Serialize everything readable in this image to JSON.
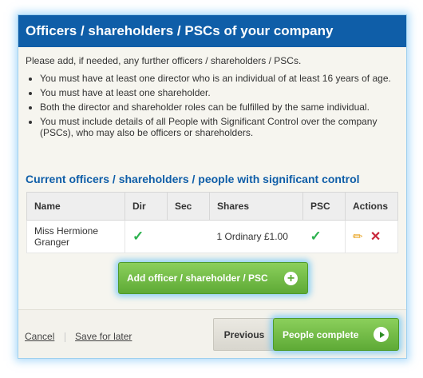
{
  "panel": {
    "title": "Officers / shareholders / PSCs of your company",
    "intro": "Please add, if needed, any further officers / shareholders / PSCs.",
    "bullets": [
      "You must have at least one director who is an individual of at least 16 years of age.",
      "You must have at least one shareholder.",
      "Both the director and shareholder roles can be fulfilled by the same individual.",
      "You must include details of all People with Significant Control over the company (PSCs), who may also be officers or shareholders."
    ]
  },
  "officers": {
    "heading": "Current officers / shareholders / people with significant control",
    "columns": [
      "Name",
      "Dir",
      "Sec",
      "Shares",
      "PSC",
      "Actions"
    ],
    "rows": [
      {
        "name": "Miss Hermione Granger",
        "dir": "✓",
        "sec": "",
        "shares": "1 Ordinary £1.00",
        "psc": "✓"
      }
    ],
    "add_button": "Add officer / shareholder / PSC"
  },
  "footer": {
    "cancel": "Cancel",
    "save": "Save for later",
    "previous": "Previous",
    "next": "People complete"
  },
  "icons": {
    "check": "check-icon",
    "edit": "pencil-icon",
    "delete": "close-icon",
    "add": "plus-circle-icon",
    "next": "arrow-right-circle-icon"
  },
  "colors": {
    "header_bg": "#0f5ea8",
    "accent_text": "#0f5ea8",
    "button_green": "#5eaa36",
    "check_green": "#2bb14d",
    "delete_red": "#c8263a",
    "edit_orange": "#e8a21e"
  }
}
